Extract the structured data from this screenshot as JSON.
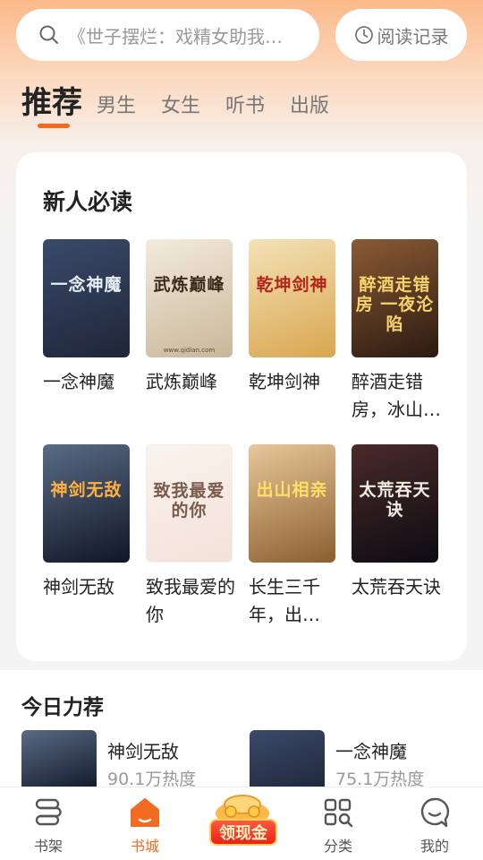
{
  "search": {
    "text": "《世子摆烂：戏精女助我…"
  },
  "history": {
    "label": "阅读记录"
  },
  "tabs": [
    {
      "label": "推荐"
    },
    {
      "label": "男生"
    },
    {
      "label": "女生"
    },
    {
      "label": "听书"
    },
    {
      "label": "出版"
    }
  ],
  "newcomer": {
    "title": "新人必读",
    "books": [
      {
        "name": "一念神魔",
        "cover_text": "一念神魔",
        "cover_colors": [
          "#3b4a6b",
          "#1e2638"
        ],
        "cover_text_color": "#e8edf6"
      },
      {
        "name": "武炼巅峰",
        "cover_text": "武炼巅峰",
        "cover_colors": [
          "#f3ebdc",
          "#c9b79a"
        ],
        "cover_text_color": "#3a2a1a",
        "cover_sub": "www.qidian.com"
      },
      {
        "name": "乾坤剑神",
        "cover_text": "乾坤剑神",
        "cover_colors": [
          "#f4e2b8",
          "#d9a64f"
        ],
        "cover_text_color": "#b3251a"
      },
      {
        "name": "醉酒走错房，冰山…",
        "cover_text": "醉酒走错房 一夜沦陷",
        "cover_colors": [
          "#8a5b34",
          "#2c1a12"
        ],
        "cover_text_color": "#f6d36b"
      },
      {
        "name": "神剑无敌",
        "cover_text": "神剑无敌",
        "cover_colors": [
          "#5a6b85",
          "#0f1626"
        ],
        "cover_text_color": "#ffb040"
      },
      {
        "name": "致我最爱的你",
        "cover_text": "致我最爱的你",
        "cover_colors": [
          "#fbf3ee",
          "#f2e2d8"
        ],
        "cover_text_color": "#7a5a4a"
      },
      {
        "name": "长生三千年，出…",
        "cover_text": "出山相亲",
        "cover_colors": [
          "#e8c79a",
          "#8a5f30"
        ],
        "cover_text_color": "#ffe066"
      },
      {
        "name": "太荒吞天诀",
        "cover_text": "太荒吞天诀",
        "cover_colors": [
          "#4a2a2a",
          "#0c0c12"
        ],
        "cover_text_color": "#f0ece0"
      }
    ]
  },
  "today": {
    "title": "今日力荐",
    "items": [
      {
        "name": "神剑无敌",
        "heat": "90.1万热度",
        "cover_colors": [
          "#5a6b85",
          "#0f1626"
        ]
      },
      {
        "name": "一念神魔",
        "heat": "75.1万热度",
        "cover_colors": [
          "#3b4a6b",
          "#1e2638"
        ]
      }
    ]
  },
  "nav": {
    "items": [
      {
        "label": "书架",
        "icon": "bookshelf-icon"
      },
      {
        "label": "书城",
        "icon": "home-icon",
        "active": true
      },
      {
        "label": "领现金",
        "icon": "cash-reward-icon"
      },
      {
        "label": "分类",
        "icon": "category-icon"
      },
      {
        "label": "我的",
        "icon": "profile-icon"
      }
    ]
  },
  "colors": {
    "accent": "#f26b21",
    "header_gradient_top": "#fbb98a"
  }
}
